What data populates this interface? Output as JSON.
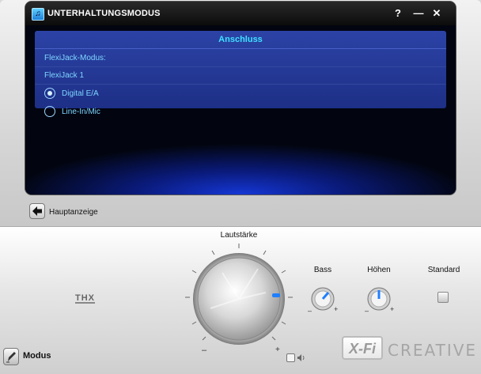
{
  "window": {
    "title": "UNTERHALTUNGSMODUS",
    "help_label": "?",
    "minimize_label": "—",
    "close_label": "✕"
  },
  "panel": {
    "section_title": "Anschluss",
    "mode_label": "FlexiJack-Modus:",
    "current_value": "FlexiJack 1",
    "options": [
      {
        "label": "Digital E/A",
        "checked": true
      },
      {
        "label": "Line-In/Mic",
        "checked": false
      }
    ]
  },
  "nav": {
    "back_label": "Hauptanzeige"
  },
  "controls": {
    "volume_label": "Lautstärke",
    "bass_label": "Bass",
    "treble_label": "Höhen",
    "standard_label": "Standard",
    "minus": "–",
    "plus": "+"
  },
  "footer": {
    "mode_label": "Modus",
    "thx_logo": "THX",
    "xfi_logo": "X-Fi",
    "brand": "CREATIVE"
  },
  "icons": {
    "app": "app-icon",
    "back": "arrow-left-icon",
    "mode": "pen-icon",
    "mute": "speaker-icon"
  },
  "colors": {
    "accent_cyan": "#3ee0ff",
    "screen_blue": "#1537d6",
    "text_light_blue": "#7fd6ff",
    "knob_indicator": "#1f7fff"
  }
}
